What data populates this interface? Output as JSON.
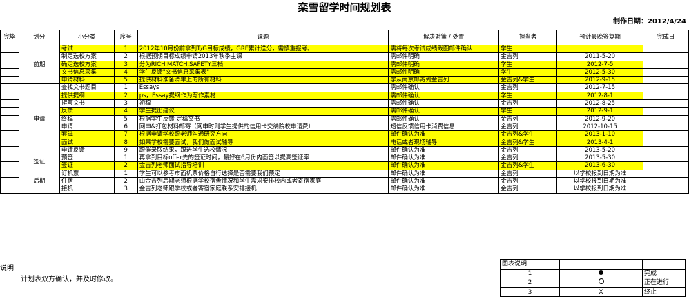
{
  "title": "栾雪留学时间规划表",
  "date": "制作日期：2012/4/24",
  "headers": [
    "完毕",
    "划分",
    "小分类",
    "序号",
    "课题",
    "解决对策 / 处置",
    "担当者",
    "预计最晚签复期",
    "完成日"
  ],
  "groups": [
    {
      "name": "前期",
      "rows": [
        {
          "sub": "考试",
          "no": "1",
          "topic": "2012年10月份前拿到T/G目标成绩，GRE累计送分，需慎重报考。",
          "action": "需将每次考试成绩截图邮件确认",
          "owner": "学生",
          "due": "",
          "yellow": true
        },
        {
          "sub": "制定选校方案",
          "no": "2",
          "topic": "根据预期目标成绩申请2013年秋季主课",
          "action": "需邮件明确",
          "owner": "金吉列",
          "due": "2011-5-20",
          "yellow": false
        },
        {
          "sub": "确定选校方案",
          "no": "3",
          "topic": "分为RICH.MATCH.SAFETY三档",
          "action": "需邮件明确",
          "owner": "学生",
          "due": "2012-7-5",
          "yellow": true
        },
        {
          "sub": "文书信息采集",
          "no": "4",
          "topic": "学生反馈\"文书信息采集表\"",
          "action": "需邮件明确",
          "owner": "学生",
          "due": "2012-5-30",
          "yellow": true
        },
        {
          "sub": "申请材料",
          "no": "5",
          "topic": "提供材料准备清单上的所有材料",
          "action": "学从南京邮寄到金吉列",
          "owner": "金吉列&学生",
          "due": "2012-9-15",
          "yellow": true
        }
      ]
    },
    {
      "name": "申请",
      "rows": [
        {
          "sub": "查找文书题目",
          "no": "1",
          "topic": "Essays",
          "action": "需邮件确认",
          "owner": "金吉列",
          "due": "2012-7-15",
          "yellow": false
        },
        {
          "sub": "提供提纲",
          "no": "2",
          "topic": "ps，Essay提纲作为写作素材",
          "action": "需邮件确认",
          "owner": "学生",
          "due": "2012-8-1",
          "yellow": true
        },
        {
          "sub": "撰写文书",
          "no": "3",
          "topic": "初稿",
          "action": "需邮件确认",
          "owner": "金吉列",
          "due": "2012-8-25",
          "yellow": false
        },
        {
          "sub": "反馈",
          "no": "4",
          "topic": "学生提出建议",
          "action": "需邮件确认",
          "owner": "学生",
          "due": "2012-9-1",
          "yellow": true
        },
        {
          "sub": "终稿",
          "no": "5",
          "topic": "根据学生反馈 定稿文书",
          "action": "需邮件确认",
          "owner": "金吉列",
          "due": "2012-9-20",
          "yellow": false
        },
        {
          "sub": "申请",
          "no": "6",
          "topic": "网申&打包材料邮寄（网申时则学生提供的信用卡交纳院校申请费）",
          "action": "短信反馈信用卡消费信息",
          "owner": "金吉列",
          "due": "2012-10-15",
          "yellow": false
        },
        {
          "sub": "套磁",
          "no": "7",
          "topic": "根据申请学校跟老师沟通研究方向",
          "action": "邮件确认为准",
          "owner": "金吉列&学生",
          "due": "2013-1-10",
          "yellow": true
        },
        {
          "sub": "面试",
          "no": "8",
          "topic": "如果学校需要面试，我们做面试辅导",
          "action": "电话或者现场辅导",
          "owner": "金吉列&学生",
          "due": "2013-4-1",
          "yellow": true
        },
        {
          "sub": "申请反馈",
          "no": "9",
          "topic": "跟催录取结果，跟进学生选校情况",
          "action": "邮件确认为准",
          "owner": "金吉列",
          "due": "2013-5-20",
          "yellow": false
        }
      ]
    },
    {
      "name": "签证",
      "rows": [
        {
          "sub": "预签",
          "no": "1",
          "topic": "再拿到目标offer先的签证时间，最好在6月份内面签以提高签证率",
          "action": "邮件确认为准",
          "owner": "金吉列",
          "due": "2013-5-30",
          "yellow": false
        },
        {
          "sub": "签证",
          "no": "2",
          "topic": "金吉列老师面试指导培训",
          "action": "邮件确认为准",
          "owner": "金吉列&学生",
          "due": "2013-6-30",
          "yellow": true
        }
      ]
    },
    {
      "name": "后期",
      "rows": [
        {
          "sub": "订机票",
          "no": "1",
          "topic": "学生可以参考市面机票价格自行选择是否需要我们预定",
          "action": "邮件确认为准",
          "owner": "金吉列",
          "due": "以学校报到日期为准",
          "yellow": false
        },
        {
          "sub": "住宿",
          "no": "2",
          "topic": "由金吉列后期老师根据学校宿舍情况和学生需求安排校内或者寄宿家庭",
          "action": "邮件确认为准",
          "owner": "金吉列",
          "due": "以学校报到日期为准",
          "yellow": false
        },
        {
          "sub": "接机",
          "no": "3",
          "topic": "金吉列老师跟学校或者寄宿家庭联系安排接机",
          "action": "邮件确认为准",
          "owner": "金吉列",
          "due": "以学校报到日期为准",
          "yellow": false
        }
      ]
    }
  ],
  "notes": {
    "label": "说明",
    "text": "计划表双方确认，并及时修改。"
  },
  "legend": {
    "title": "图表说明",
    "items": [
      {
        "no": "1",
        "symbol": "filled-circle-icon",
        "label": "完成"
      },
      {
        "no": "2",
        "symbol": "hollow-circle-icon",
        "label": "正在进行"
      },
      {
        "no": "3",
        "symbol": "X",
        "label": "终止"
      }
    ]
  },
  "colors": {
    "highlight": "#ffff00"
  }
}
